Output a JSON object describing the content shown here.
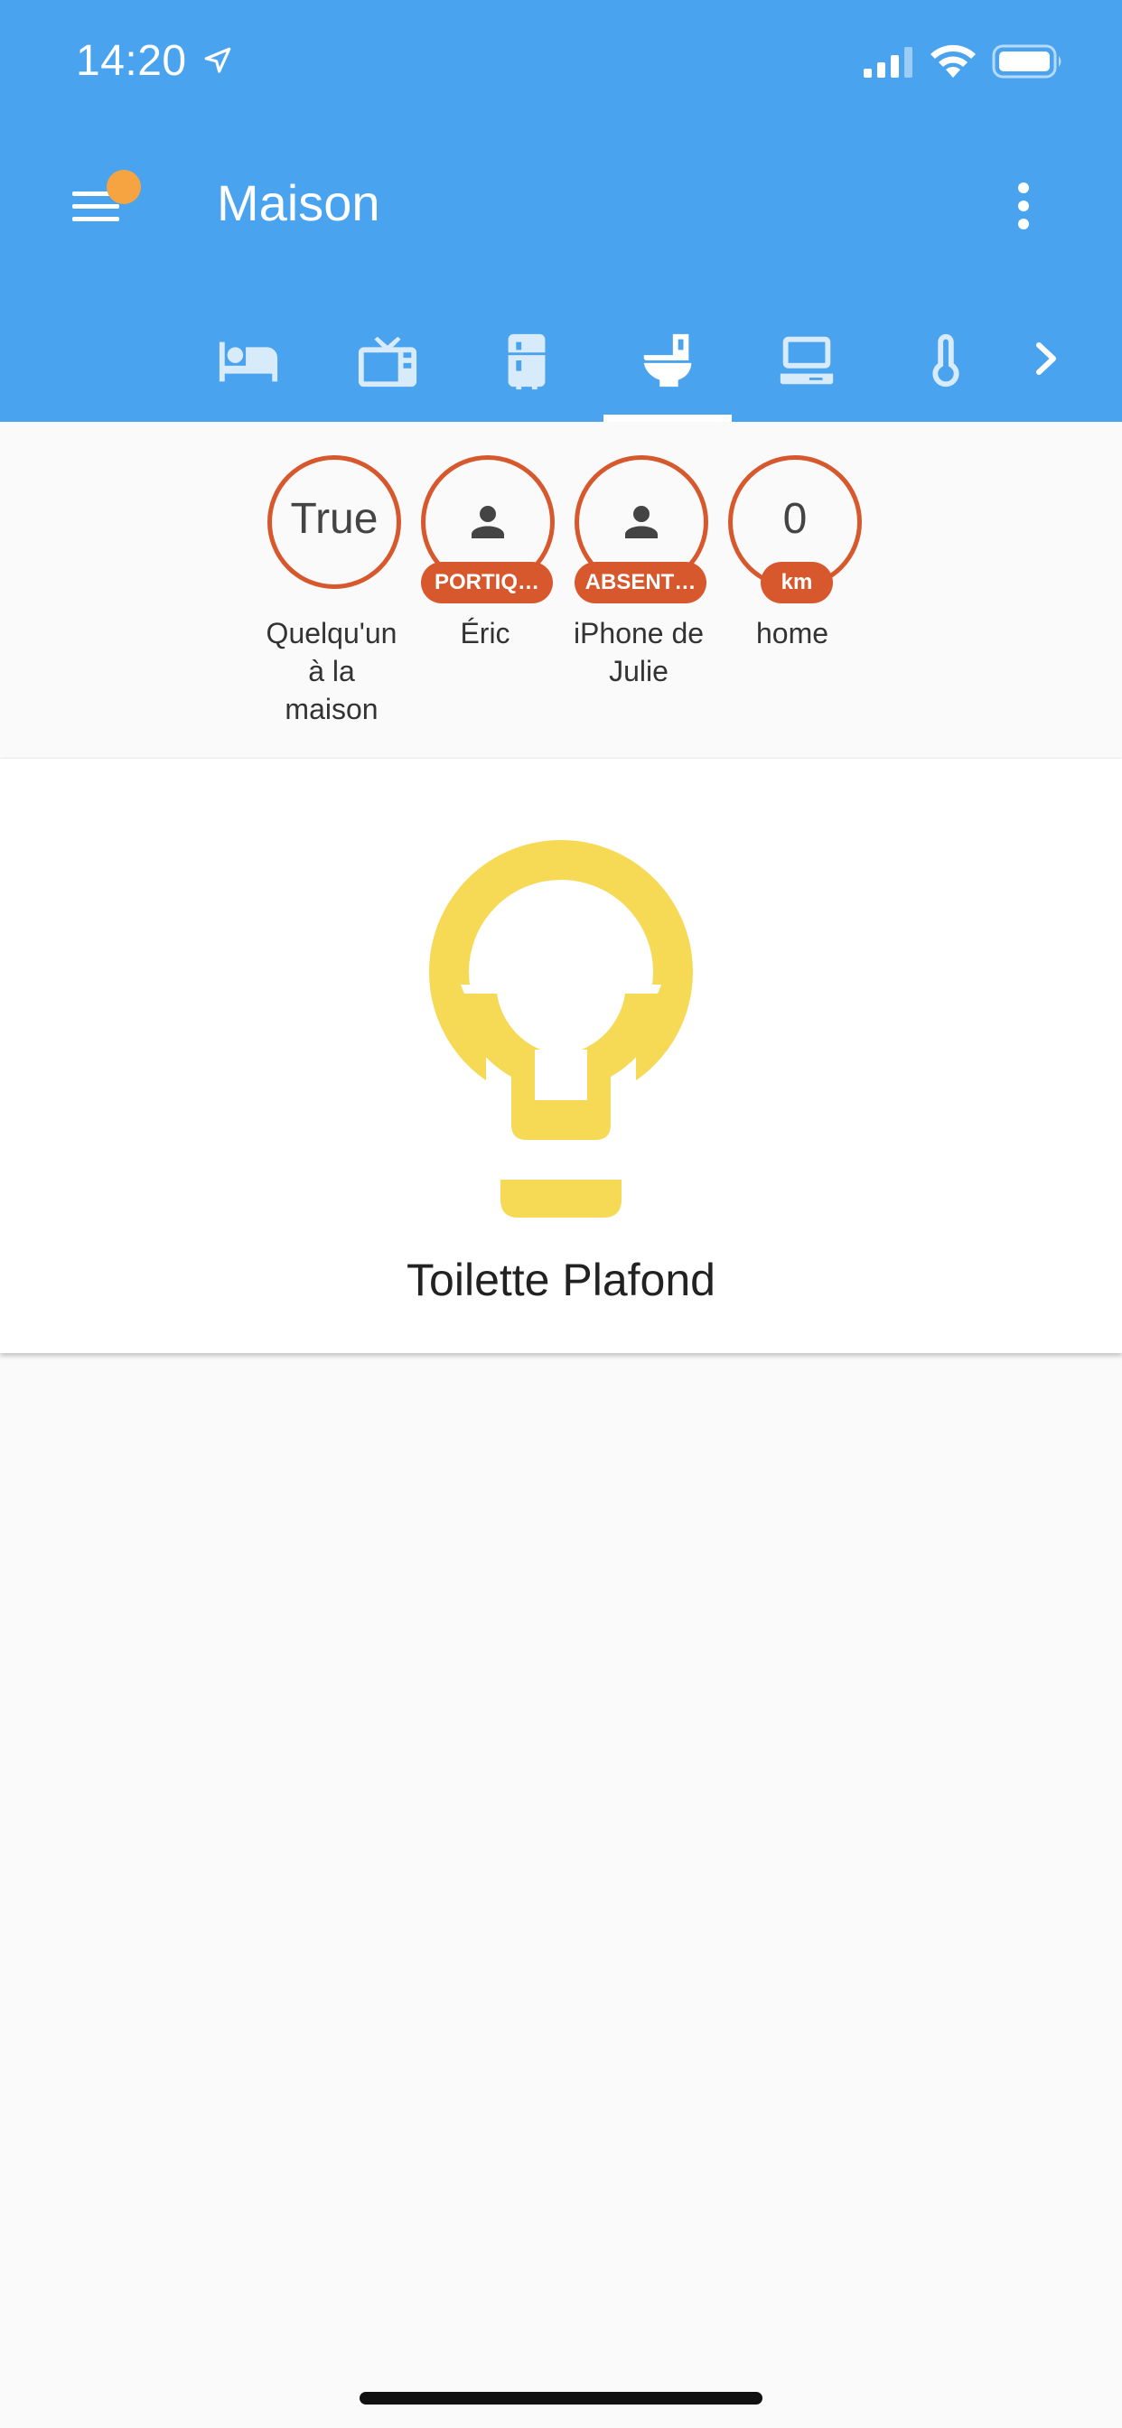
{
  "status_bar": {
    "time": "14:20"
  },
  "header": {
    "title": "Maison",
    "accent_color": "#4aa3ee",
    "notification_dot_color": "#f5a441"
  },
  "tabs": [
    {
      "icon": "bed-icon",
      "selected": false
    },
    {
      "icon": "tv-icon",
      "selected": false
    },
    {
      "icon": "fridge-icon",
      "selected": false
    },
    {
      "icon": "toilet-icon",
      "selected": true
    },
    {
      "icon": "laptop-icon",
      "selected": false
    },
    {
      "icon": "thermometer-icon",
      "selected": false
    }
  ],
  "badges": [
    {
      "value": "True",
      "name_lines": [
        "Quelqu'un",
        "à la",
        "maison"
      ]
    },
    {
      "chip": "PORTIQ…",
      "name_lines": [
        "Éric"
      ]
    },
    {
      "chip": "ABSENT…",
      "name_lines": [
        "iPhone de",
        "Julie"
      ]
    },
    {
      "value": "0",
      "chip": "km",
      "name_lines": [
        "home"
      ]
    }
  ],
  "badge_color": "#d6582c",
  "card": {
    "label": "Toilette Plafond",
    "icon": "lightbulb-icon",
    "icon_color": "#f6d955"
  }
}
